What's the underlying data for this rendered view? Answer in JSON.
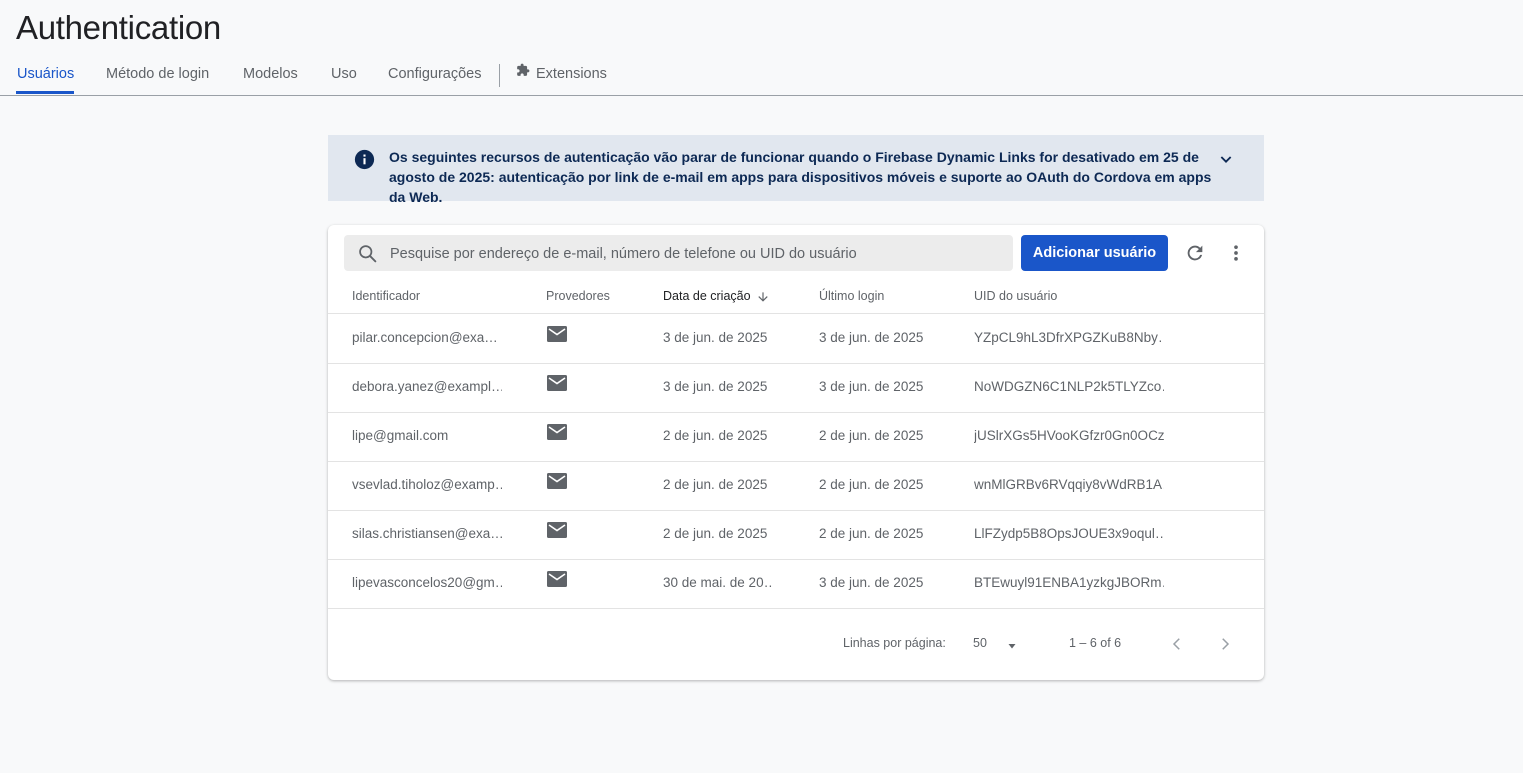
{
  "page_title": "Authentication",
  "tabs": [
    {
      "label": "Usuários",
      "active": true
    },
    {
      "label": "Método de login"
    },
    {
      "label": "Modelos"
    },
    {
      "label": "Uso"
    },
    {
      "label": "Configurações"
    },
    {
      "label": "Extensions",
      "icon": "extensions-icon"
    }
  ],
  "banner": {
    "icon": "info-icon",
    "text": "Os seguintes recursos de autenticação vão parar de funcionar quando o Firebase Dynamic Links for desativado em 25 de agosto de 2025: autenticação por link de e-mail em apps para dispositivos móveis e suporte ao OAuth do Cordova em apps da Web.",
    "expand_icon": "chevron-down-icon"
  },
  "toolbar": {
    "search_placeholder": "Pesquise por endereço de e-mail, número de telefone ou UID do usuário",
    "add_user_label": "Adicionar usuário",
    "refresh_icon": "refresh-icon",
    "more_icon": "more-vert-icon"
  },
  "table": {
    "columns": [
      "Identificador",
      "Provedores",
      "Data de criação",
      "Último login",
      "UID do usuário"
    ],
    "sorted_column": "Data de criação",
    "sort_direction": "descending",
    "rows": [
      {
        "identifier": "pilar.concepcion@exa…",
        "provider": "email-icon",
        "created": "3 de jun. de 2025",
        "last_login": "3 de jun. de 2025",
        "uid": "YZpCL9hL3DfrXPGZKuB8Nby…"
      },
      {
        "identifier": "debora.yanez@exampl…",
        "provider": "email-icon",
        "created": "3 de jun. de 2025",
        "last_login": "3 de jun. de 2025",
        "uid": "NoWDGZN6C1NLP2k5TLYZco…"
      },
      {
        "identifier": "lipe@gmail.com",
        "provider": "email-icon",
        "created": "2 de jun. de 2025",
        "last_login": "2 de jun. de 2025",
        "uid": "jUSlrXGs5HVooKGfzr0Gn0OCz…"
      },
      {
        "identifier": "vsevlad.tiholoz@examp…",
        "provider": "email-icon",
        "created": "2 de jun. de 2025",
        "last_login": "2 de jun. de 2025",
        "uid": "wnMlGRBv6RVqqiy8vWdRB1A…"
      },
      {
        "identifier": "silas.christiansen@exa…",
        "provider": "email-icon",
        "created": "2 de jun. de 2025",
        "last_login": "2 de jun. de 2025",
        "uid": "LlFZydp5B8OpsJOUE3x9oqul…"
      },
      {
        "identifier": "lipevasconcelos20@gm…",
        "provider": "email-icon",
        "created": "30 de mai. de 20…",
        "last_login": "3 de jun. de 2025",
        "uid": "BTEwuyl91ENBA1yzkgJBORm…"
      }
    ]
  },
  "pagination": {
    "rows_per_page_label": "Linhas por página:",
    "rows_per_page_value": "50",
    "range": "1 – 6 of 6"
  },
  "colors": {
    "accent": "#1a56c9",
    "banner_bg": "#e1e7ef",
    "banner_text": "#0d2954"
  }
}
